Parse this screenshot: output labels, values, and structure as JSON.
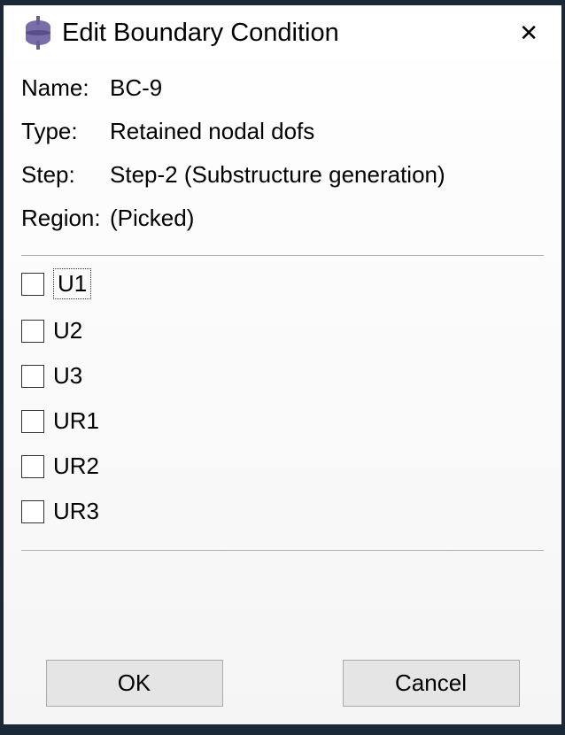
{
  "dialog": {
    "title": "Edit Boundary Condition",
    "info": {
      "name_label": "Name:",
      "name_value": "BC-9",
      "type_label": "Type:",
      "type_value": "Retained nodal dofs",
      "step_label": "Step:",
      "step_value": "Step-2 (Substructure generation)",
      "region_label": "Region:",
      "region_value": "(Picked)"
    },
    "dofs": [
      {
        "label": "U1",
        "checked": false,
        "focused": true
      },
      {
        "label": "U2",
        "checked": false,
        "focused": false
      },
      {
        "label": "U3",
        "checked": false,
        "focused": false
      },
      {
        "label": "UR1",
        "checked": false,
        "focused": false
      },
      {
        "label": "UR2",
        "checked": false,
        "focused": false
      },
      {
        "label": "UR3",
        "checked": false,
        "focused": false
      }
    ],
    "buttons": {
      "ok": "OK",
      "cancel": "Cancel"
    }
  }
}
